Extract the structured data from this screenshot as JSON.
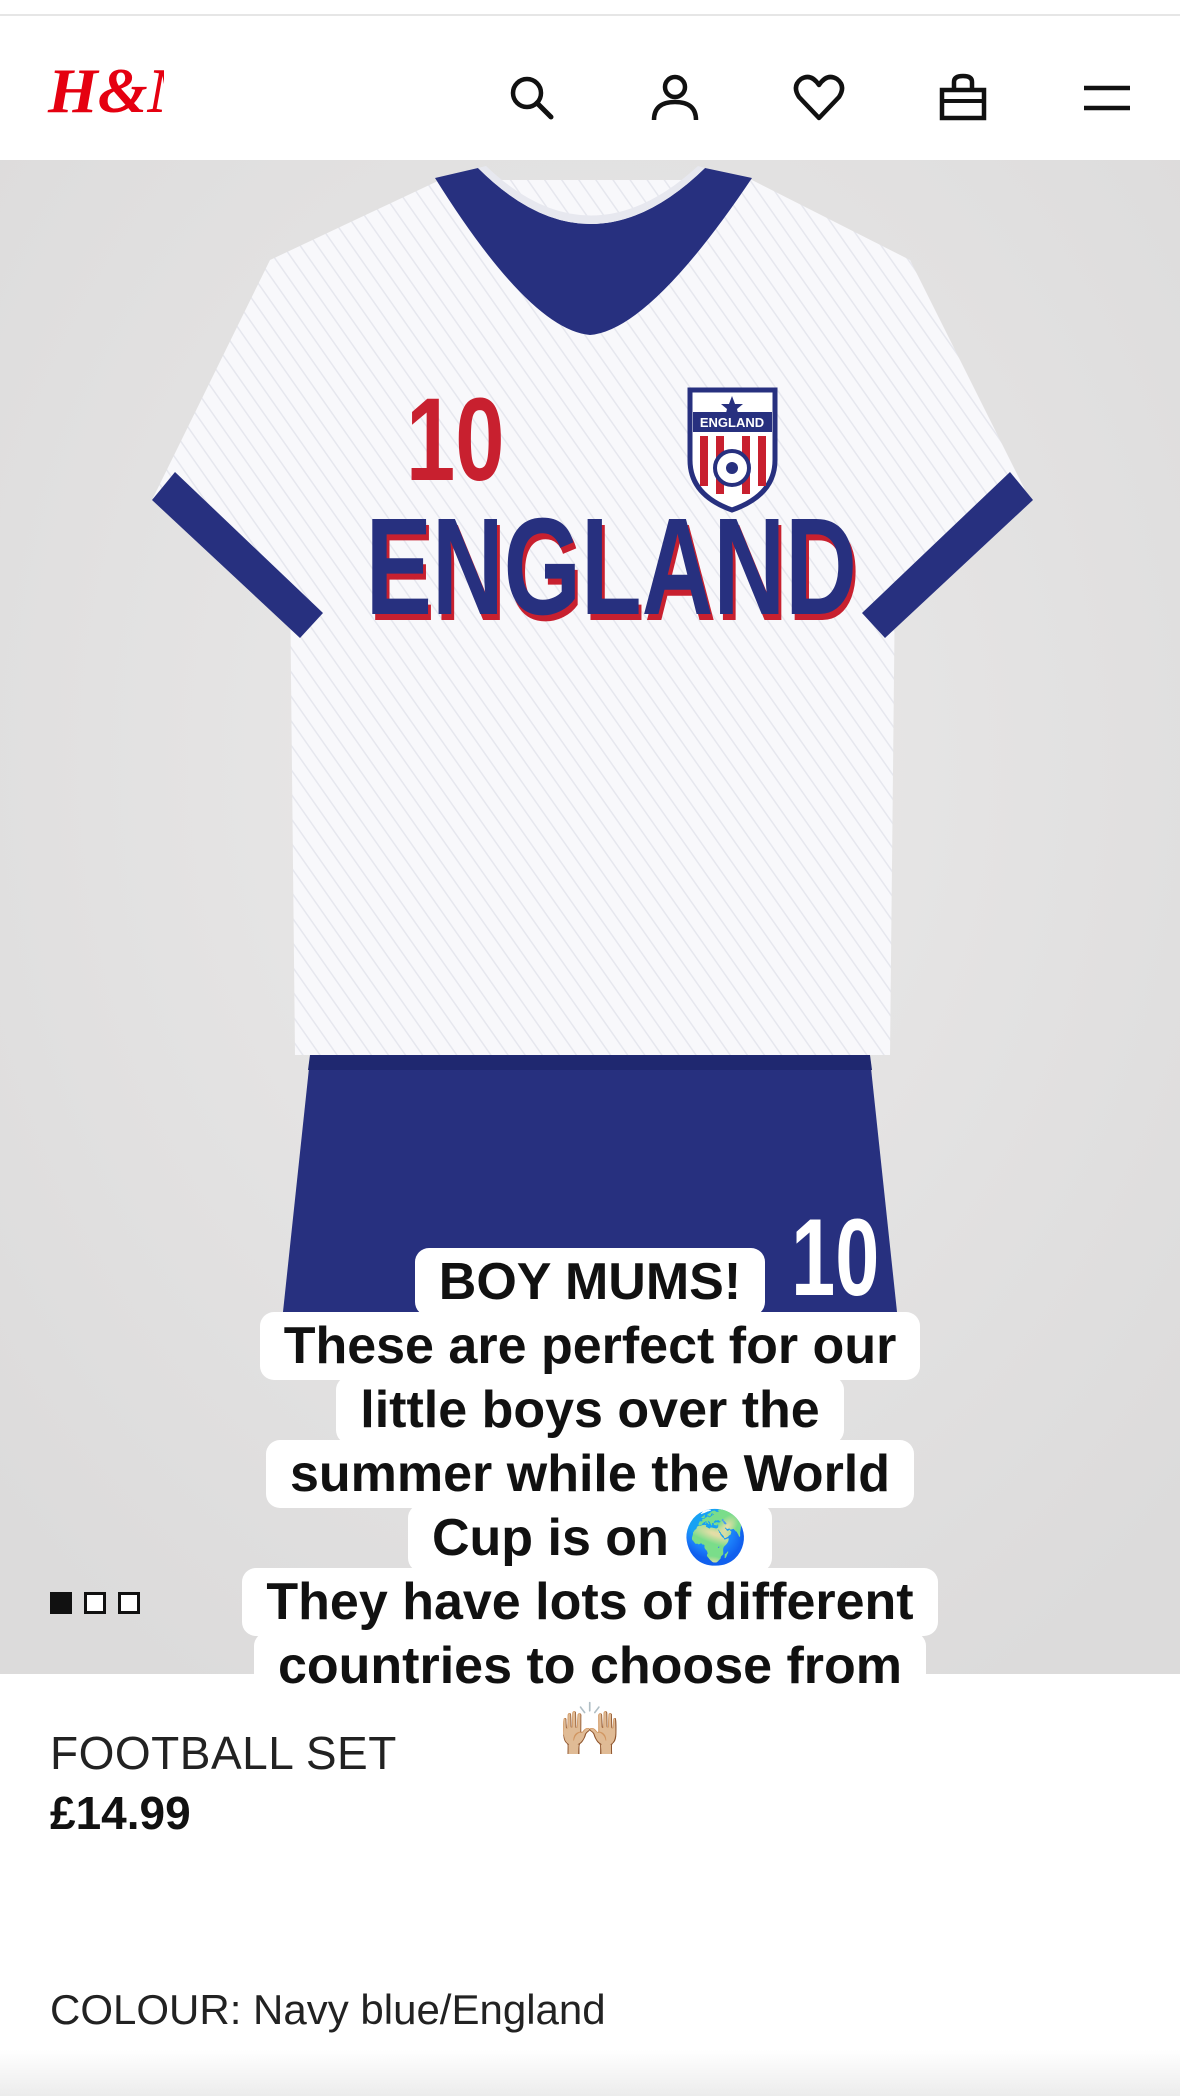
{
  "header": {
    "logo_text": "H&M",
    "icons": [
      "search-icon",
      "account-icon",
      "heart-icon",
      "bag-icon",
      "menu-icon"
    ],
    "brand_color": "#e50010"
  },
  "image": {
    "shirt_number": "10",
    "shirt_text": "ENGLAND",
    "crest_text": "ENGLAND",
    "shorts_number": "10",
    "carousel_total": 3,
    "carousel_active": 1,
    "navy_color": "#27307f",
    "red_color": "#c8202f"
  },
  "caption": {
    "lines": [
      "BOY MUMS!",
      "These are perfect for our",
      "little boys over the",
      "summer while the World",
      "Cup is on 🌍",
      "They have lots of different",
      "countries to choose from",
      "🙌🏼"
    ]
  },
  "product": {
    "name": "FOOTBALL SET",
    "price": "£14.99",
    "colour_label": "COLOUR:",
    "colour_value": "Navy blue/England"
  }
}
